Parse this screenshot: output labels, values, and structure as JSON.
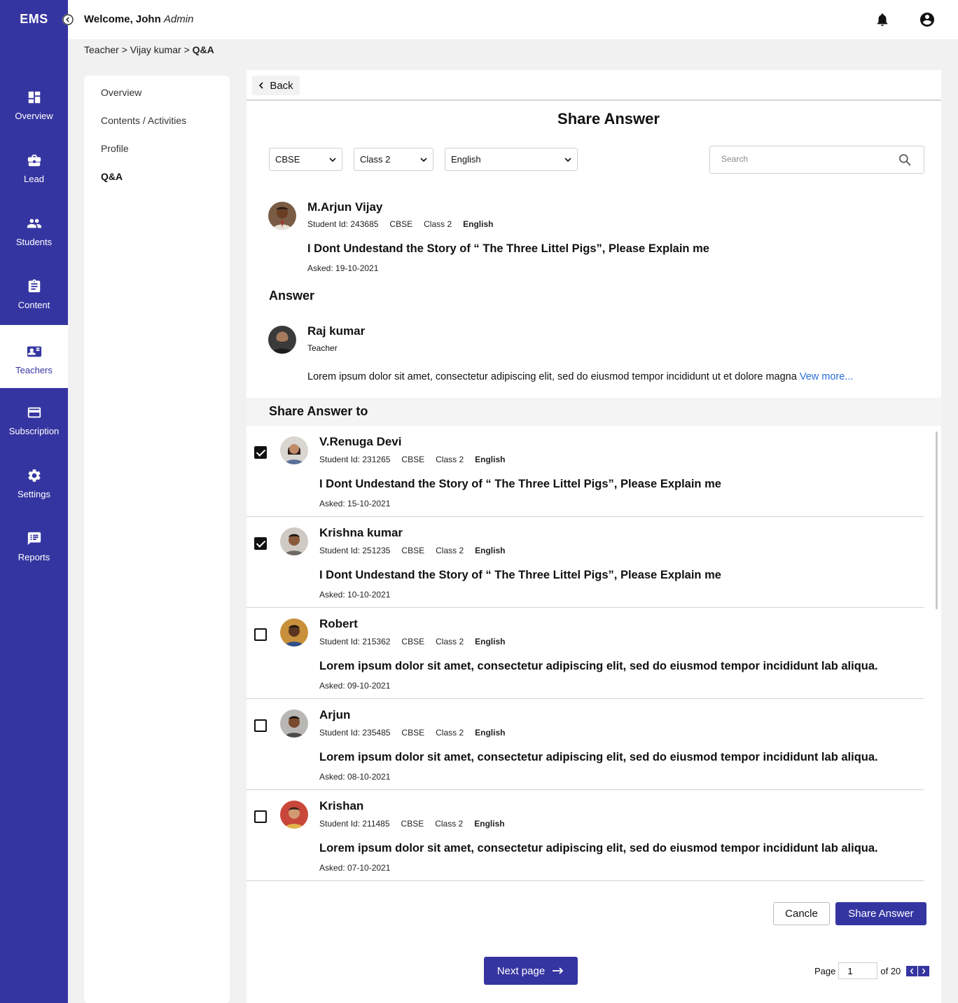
{
  "app": {
    "logo": "EMS"
  },
  "nav": {
    "items": [
      {
        "label": "Overview",
        "icon": "dashboard-icon"
      },
      {
        "label": "Lead",
        "icon": "briefcase-icon"
      },
      {
        "label": "Students",
        "icon": "people-icon"
      },
      {
        "label": "Content",
        "icon": "clipboard-icon"
      },
      {
        "label": "Teachers",
        "icon": "teacher-card-icon",
        "active": true
      },
      {
        "label": "Subscription",
        "icon": "card-icon"
      },
      {
        "label": "Settings",
        "icon": "gear-icon"
      },
      {
        "label": "Reports",
        "icon": "report-chat-icon"
      }
    ]
  },
  "topbar": {
    "welcome": "Welcome, John",
    "role": "Admin"
  },
  "breadcrumb": {
    "p1": "Teacher",
    "sep": ">",
    "p2": "Vijay kumar",
    "current": "Q&A"
  },
  "submenu": {
    "items": [
      "Overview",
      "Contents / Activities",
      "Profile",
      "Q&A"
    ],
    "active": "Q&A"
  },
  "main": {
    "back": "Back",
    "title": "Share Answer",
    "filters": {
      "board": "CBSE",
      "class": "Class 2",
      "subject": "English"
    },
    "search_placeholder": "Search"
  },
  "question": {
    "name": "M.Arjun Vijay",
    "student_id": "Student Id: 243685",
    "board": "CBSE",
    "class": "Class 2",
    "subject": "English",
    "text": "I Dont Undestand the Story of “ The Three Littel Pigs”, Please Explain me",
    "asked": "Asked: 19-10-2021"
  },
  "answer": {
    "heading": "Answer",
    "name": "Raj kumar",
    "role": "Teacher",
    "text": "Lorem ipsum dolor sit amet, consectetur adipiscing elit, sed do eiusmod tempor incididunt ut et dolore magna",
    "more": "Vew more..."
  },
  "share_to": {
    "heading": "Share Answer to",
    "rows": [
      {
        "checked": true,
        "name": "V.Renuga Devi",
        "student_id": "Student Id: 231265",
        "board": "CBSE",
        "class": "Class 2",
        "subject": "English",
        "text": "I Dont Undestand the Story of “ The Three Littel Pigs”, Please Explain me",
        "asked": "Asked: 15-10-2021"
      },
      {
        "checked": true,
        "name": "Krishna kumar",
        "student_id": "Student Id: 251235",
        "board": "CBSE",
        "class": "Class 2",
        "subject": "English",
        "text": "I Dont Undestand the Story of “ The Three Littel Pigs”, Please Explain me",
        "asked": "Asked: 10-10-2021"
      },
      {
        "checked": false,
        "name": "Robert",
        "student_id": "Student Id: 215362",
        "board": "CBSE",
        "class": "Class 2",
        "subject": "English",
        "text": "Lorem ipsum dolor sit amet, consectetur adipiscing elit, sed do eiusmod tempor incididunt  lab aliqua.",
        "asked": "Asked: 09-10-2021"
      },
      {
        "checked": false,
        "name": "Arjun",
        "student_id": "Student Id: 235485",
        "board": "CBSE",
        "class": "Class 2",
        "subject": "English",
        "text": "Lorem ipsum dolor sit amet, consectetur adipiscing elit, sed do eiusmod tempor incididunt  lab aliqua.",
        "asked": "Asked: 08-10-2021"
      },
      {
        "checked": false,
        "name": "Krishan",
        "student_id": "Student Id: 211485",
        "board": "CBSE",
        "class": "Class 2",
        "subject": "English",
        "text": "Lorem ipsum dolor sit amet, consectetur adipiscing elit, sed do eiusmod tempor incididunt  lab aliqua.",
        "asked": "Asked: 07-10-2021"
      }
    ]
  },
  "actions": {
    "cancel": "Cancle",
    "share": "Share Answer",
    "next": "Next page"
  },
  "pagination": {
    "page_label": "Page",
    "current": "1",
    "of_label": "of 20"
  },
  "colors": {
    "primary": "#3535a1",
    "link": "#2a6fdb"
  }
}
